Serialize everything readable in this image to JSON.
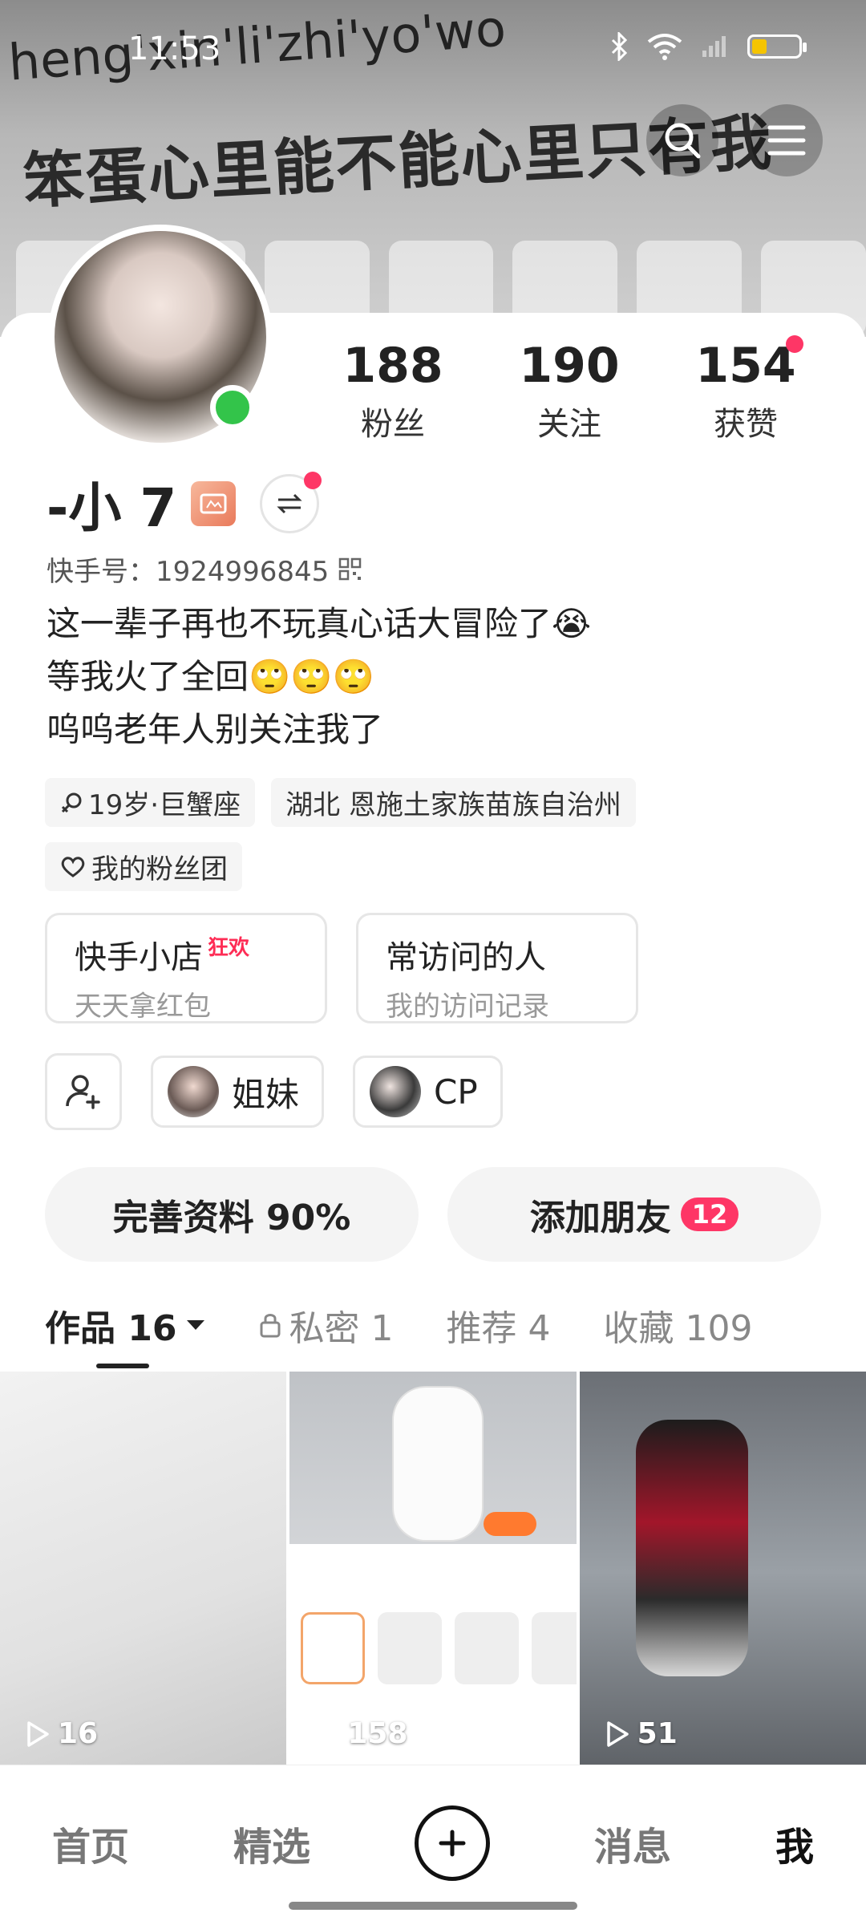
{
  "status": {
    "time": "11:53"
  },
  "banner": {
    "pinyin": "heng'xin'li'zhi'yo'wo",
    "phrase": "笨蛋心里能不能心里只有我"
  },
  "stats": [
    {
      "value": "188",
      "label": "粉丝"
    },
    {
      "value": "190",
      "label": "关注"
    },
    {
      "value": "154",
      "label": "获赞"
    }
  ],
  "profile": {
    "name": "-小 7",
    "ks_id": "快手号：1924996845",
    "bio": [
      "这一辈子再也不玩真心话大冒险了😭",
      "等我火了全回🙄🙄🙄",
      "呜呜老年人别关注我了"
    ],
    "tag_age": "19岁·巨蟹座",
    "tag_location": "湖北 恩施土家族苗族自治州",
    "tag_fans": "我的粉丝团"
  },
  "entries": [
    {
      "title": "快手小店",
      "hot": "狂欢",
      "sub": "天天拿红包"
    },
    {
      "title": "常访问的人",
      "sub": "我的访问记录"
    }
  ],
  "friends": [
    {
      "label": "姐妹"
    },
    {
      "label": "CP"
    }
  ],
  "actions": {
    "complete": "完善资料 90%",
    "add_friend": "添加朋友",
    "add_friend_count": "12"
  },
  "tabs": {
    "works": "作品 16",
    "private": "私密 1",
    "recommend": "推荐 4",
    "favorites": "收藏 109"
  },
  "videos": [
    {
      "plays": "16"
    },
    {
      "plays": "158"
    },
    {
      "plays": "51"
    }
  ],
  "nav": {
    "home": "首页",
    "featured": "精选",
    "messages": "消息",
    "me": "我"
  },
  "colors": {
    "accent": "#fe3666",
    "online": "#33c44a",
    "battery": "#f5c400"
  }
}
